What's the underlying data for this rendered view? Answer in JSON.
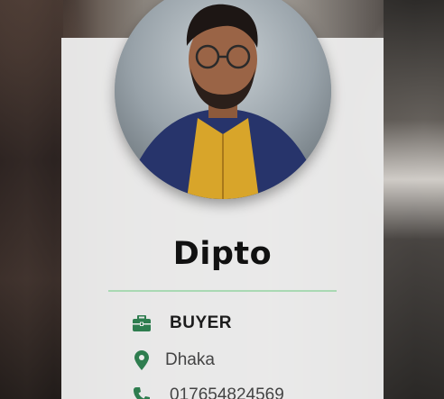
{
  "profile": {
    "name": "Dipto",
    "role": "BUYER",
    "location": "Dhaka",
    "phone": "017654824569"
  },
  "icons": {
    "role": "briefcase-icon",
    "location": "map-pin-icon",
    "phone": "phone-icon"
  },
  "colors": {
    "accent_green": "#2e7d4f",
    "divider": "#a9d9b3",
    "card_bg": "#ececec"
  }
}
